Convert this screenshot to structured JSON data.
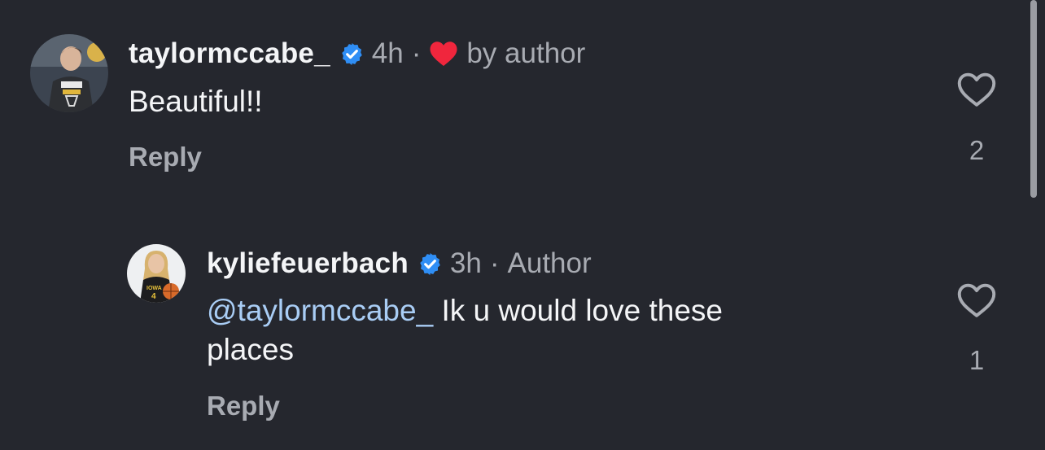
{
  "comments": [
    {
      "username": "taylormccabe_",
      "time": "4h",
      "separator": "·",
      "liked_by_author_label": "by author",
      "text": "Beautiful!!",
      "reply_label": "Reply",
      "like_count": "2"
    },
    {
      "username": "kyliefeuerbach",
      "time": "3h",
      "separator": "·",
      "author_label": "Author",
      "mention": "@taylormccabe_",
      "text_line1": " Ik u would love these",
      "text_line2": "places",
      "reply_label": "Reply",
      "like_count": "1"
    }
  ],
  "colors": {
    "background": "#25272e",
    "verified_badge": "#2f8ef5",
    "heart_red": "#f0263d",
    "mention": "#a9cdf5",
    "secondary_text": "#a8abb2"
  },
  "icons": {
    "verified": "verified-badge-icon",
    "liked_by_author": "heart-filled-icon",
    "like": "heart-outline-icon"
  }
}
